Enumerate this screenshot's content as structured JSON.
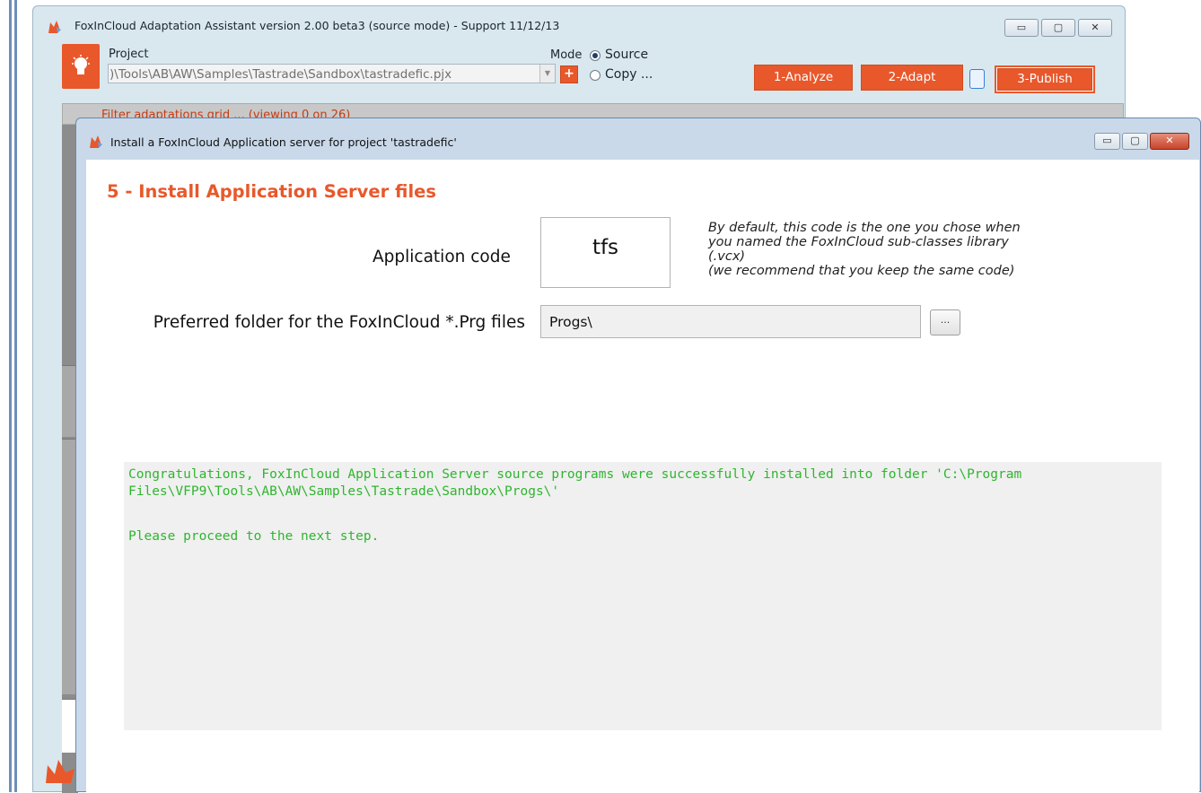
{
  "back_window": {
    "title": "FoxInCloud Adaptation Assistant version 2.00 beta3 (source mode) - Support 11/12/13",
    "project_label": "Project",
    "project_path": ")\\Tools\\AB\\AW\\Samples\\Tastrade\\Sandbox\\tastradefic.pjx",
    "add_label": "+",
    "mode_label": "Mode",
    "mode_source": "Source",
    "mode_copy": "Copy ...",
    "btn_analyze": "1-Analyze",
    "btn_adapt": "2-Adapt",
    "btn_publish": "3-Publish",
    "filter_text": "Filter adaptations grid ... (viewing 0 on 26)"
  },
  "dialog": {
    "title": "Install a FoxInCloud Application server for project 'tastradefic'",
    "step_title": "5 - Install Application Server files",
    "app_code_label": "Application code",
    "app_code_value": "tfs",
    "hint_lines": [
      "By default, this code is the one you chose when",
      "you named the FoxInCloud sub-classes library",
      "(.vcx)",
      "(we recommend that you keep the same code)"
    ],
    "folder_label": "Preferred folder for the FoxInCloud *.Prg files",
    "folder_value": "Progs\\",
    "browse_label": "...",
    "message_lines": [
      "Congratulations, FoxInCloud Application Server source programs were successfully installed into folder 'C:\\Program",
      "Files\\VFP9\\Tools\\AB\\AW\\Samples\\Tastrade\\Sandbox\\Progs\\'",
      "",
      "Please proceed to the next step."
    ]
  },
  "caption_buttons": {
    "minimize": "▭",
    "maximize": "▢",
    "close": "✕"
  },
  "colors": {
    "accent_orange": "#e8582b",
    "success_green": "#2fb52f"
  }
}
